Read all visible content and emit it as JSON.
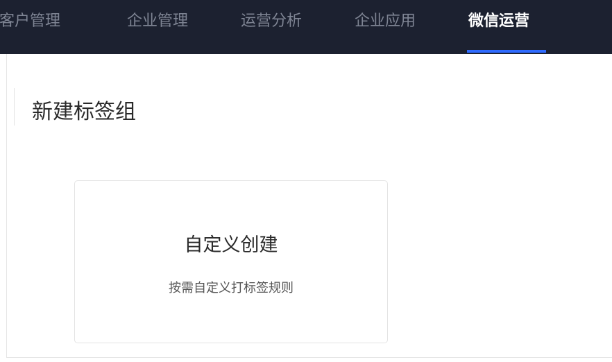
{
  "nav": {
    "items": [
      {
        "label": "客户管理"
      },
      {
        "label": "企业管理"
      },
      {
        "label": "运营分析"
      },
      {
        "label": "企业应用"
      },
      {
        "label": "微信运营"
      }
    ],
    "active_index": 4,
    "background_color": "#1c2130",
    "accent_color": "#2f6bff"
  },
  "page": {
    "title": "新建标签组"
  },
  "card": {
    "title": "自定义创建",
    "description": "按需自定义打标签规则"
  }
}
